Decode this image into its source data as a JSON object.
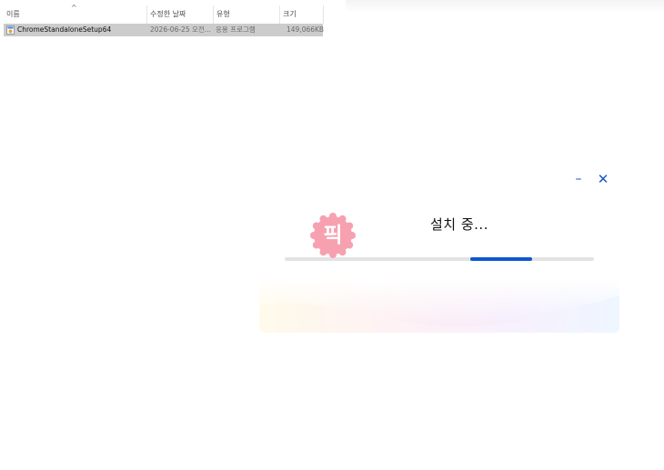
{
  "explorer": {
    "columns": {
      "name": "이름",
      "date": "수정한 날짜",
      "type": "유형",
      "size": "크기"
    },
    "sort_indicator": "^",
    "file": {
      "name": "ChromeStandaloneSetup64",
      "date": "2026-06-25 오전...",
      "type": "응용 프로그램",
      "size": "149,066KB",
      "icon": "installer-app-icon"
    },
    "selected_color": "#cccccc"
  },
  "installer": {
    "status_text": "설치 중...",
    "badge_text": "픽",
    "minimize_glyph": "–",
    "close_glyph": "✕",
    "progress": {
      "indeterminate": true,
      "segment_start_fraction": 0.6,
      "segment_end_fraction": 0.8
    },
    "colors": {
      "accent": "#0b57d0",
      "badge": "#f7a1b0",
      "track": "#e3e3e3"
    }
  }
}
